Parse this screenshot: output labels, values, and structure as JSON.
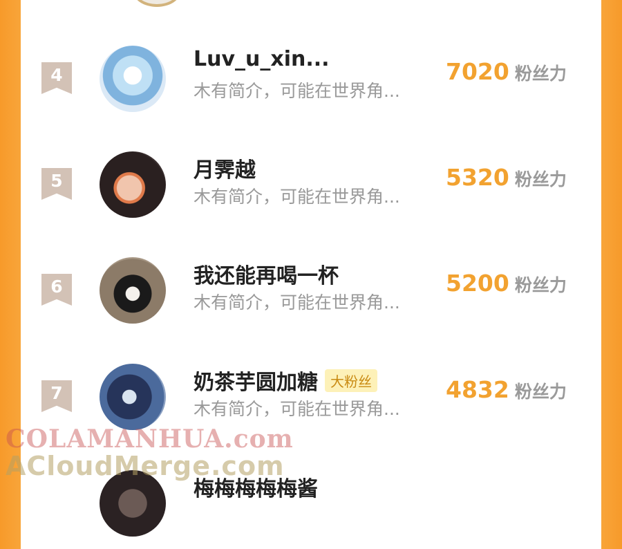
{
  "rows": [
    {
      "rank": "4",
      "name": "Luv_u_xin...",
      "bio": "木有简介，可能在世界角...",
      "score": "7020",
      "unit": "粉丝力",
      "badge": ""
    },
    {
      "rank": "5",
      "name": "月霁越",
      "bio": "木有简介，可能在世界角...",
      "score": "5320",
      "unit": "粉丝力",
      "badge": ""
    },
    {
      "rank": "6",
      "name": "我还能再喝一杯",
      "bio": "木有简介，可能在世界角...",
      "score": "5200",
      "unit": "粉丝力",
      "badge": ""
    },
    {
      "rank": "7",
      "name": "奶茶芋圆加糖",
      "bio": "木有简介，可能在世界角...",
      "score": "4832",
      "unit": "粉丝力",
      "badge": "大粉丝"
    },
    {
      "rank": "",
      "name": "梅梅梅梅梅酱",
      "bio": "",
      "score": "",
      "unit": "",
      "badge": ""
    }
  ],
  "watermark": {
    "line1": "COLAMANHUA.com",
    "line2": "ACloudMerge.com"
  }
}
